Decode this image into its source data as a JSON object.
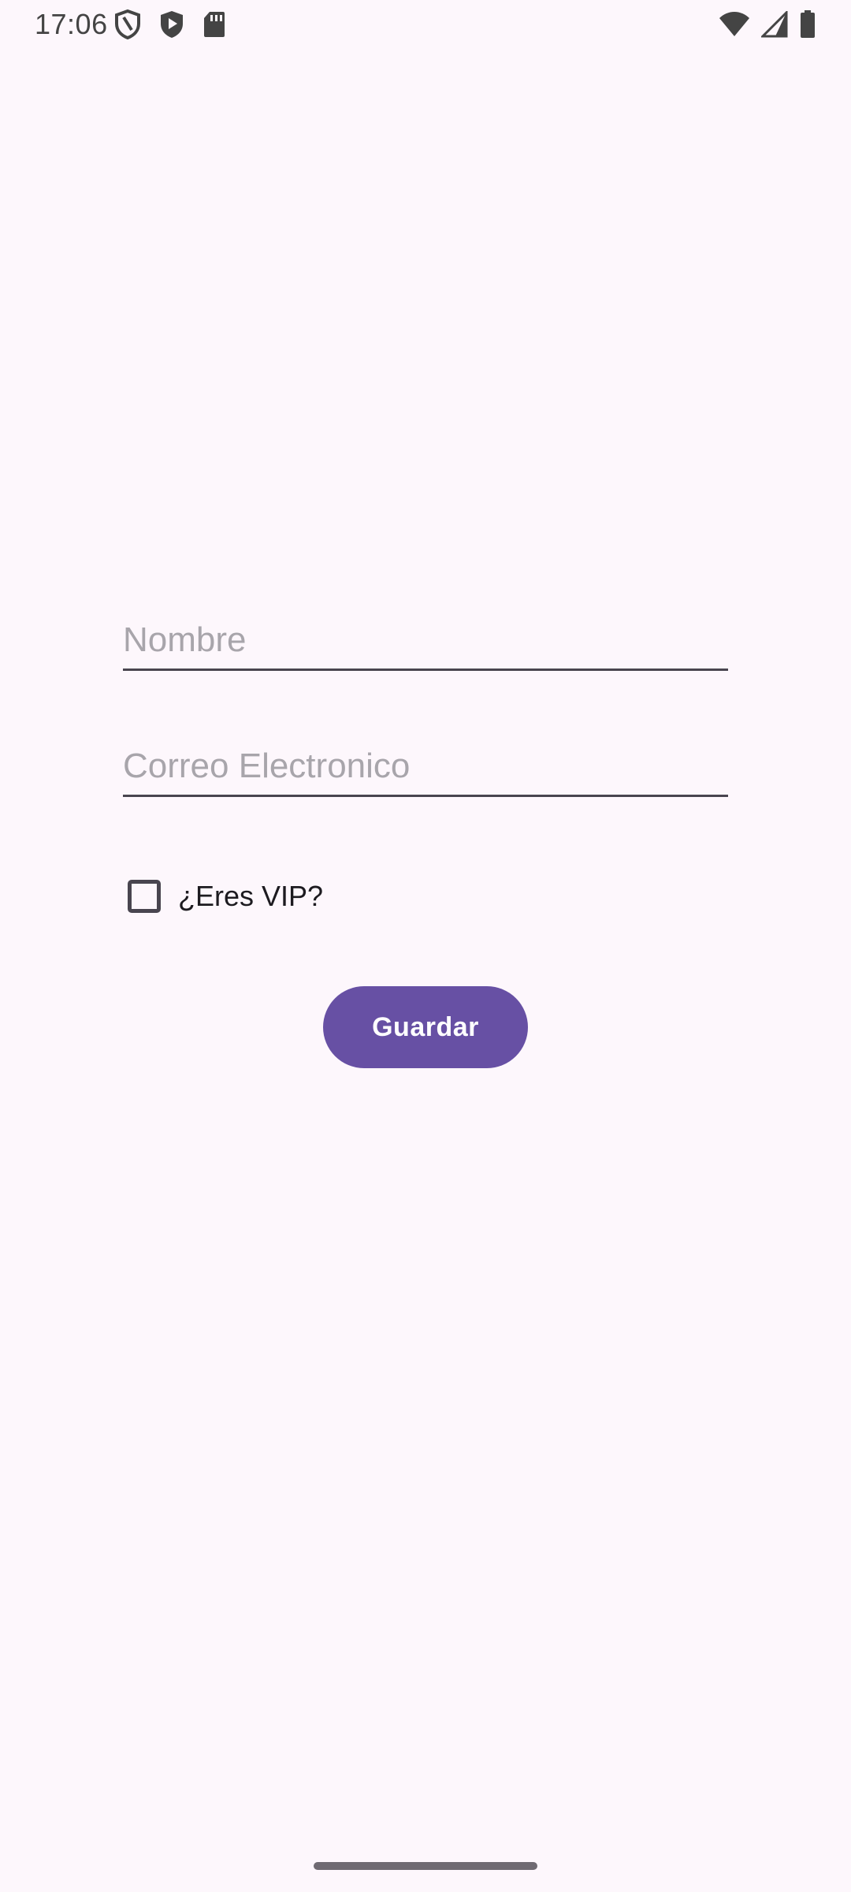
{
  "status_bar": {
    "time": "17:06",
    "left_icons": [
      "shield-outline-icon",
      "play-shield-icon",
      "sd-card-icon"
    ],
    "right_icons": [
      "wifi-icon",
      "cell-signal-icon",
      "battery-icon"
    ]
  },
  "form": {
    "name_placeholder": "Nombre",
    "name_value": "",
    "email_placeholder": "Correo Electronico",
    "email_value": "",
    "vip_label": "¿Eres VIP?",
    "vip_checked": false,
    "save_label": "Guardar"
  },
  "colors": {
    "background": "#fdf7fc",
    "primary": "#6750a4",
    "outline": "#49454f",
    "placeholder": "#a8a5ab"
  }
}
